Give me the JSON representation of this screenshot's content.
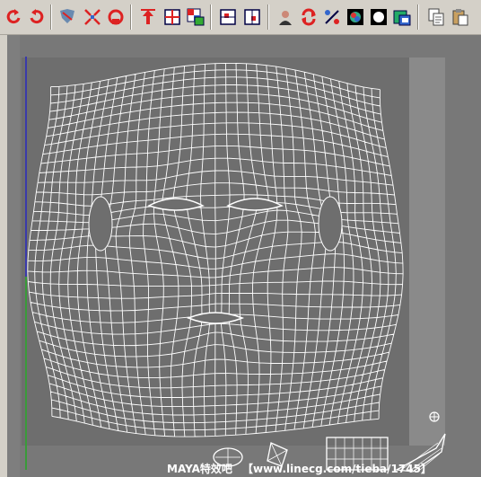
{
  "toolbar": {
    "buttons": [
      {
        "id": "rotate-ccw",
        "icon": "rotate-left-icon"
      },
      {
        "id": "rotate-cw",
        "icon": "rotate-right-icon"
      },
      {
        "id": "flip-uv",
        "icon": "flip-icon"
      },
      {
        "id": "cycle-uv",
        "icon": "cycle-icon"
      },
      {
        "id": "unfold",
        "icon": "unfold-icon"
      },
      {
        "id": "move-up",
        "icon": "arrow-up-icon"
      },
      {
        "id": "grid",
        "icon": "grid-icon"
      },
      {
        "id": "checker",
        "icon": "checker-icon"
      },
      {
        "id": "snap-in",
        "icon": "snap-in-icon"
      },
      {
        "id": "snap-out",
        "icon": "snap-out-icon"
      },
      {
        "id": "image-toggle",
        "icon": "portrait-icon"
      },
      {
        "id": "refresh",
        "icon": "refresh-icon"
      },
      {
        "id": "ratio",
        "icon": "ratio-icon"
      },
      {
        "id": "color",
        "icon": "color-wheel-icon"
      },
      {
        "id": "dim",
        "icon": "circle-icon"
      },
      {
        "id": "texture",
        "icon": "texture-icon"
      },
      {
        "id": "copy",
        "icon": "copy-icon"
      },
      {
        "id": "paste",
        "icon": "paste-icon"
      }
    ]
  },
  "watermark": {
    "left": "MAYA特效吧",
    "right": "【www.linecg.com/tieba/1745】"
  },
  "colors": {
    "viewport_bg": "#787878",
    "mesh_line": "#ffffff",
    "axis_v": "#3a3aaa",
    "axis_g": "#3a9a3a"
  }
}
